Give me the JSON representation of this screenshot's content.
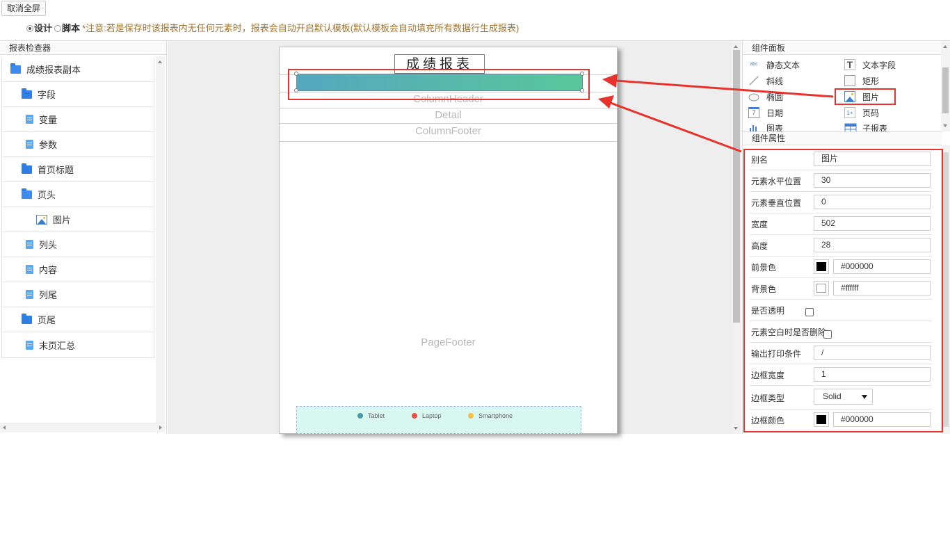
{
  "toolbar": {
    "exit_fullscreen": "取消全屏"
  },
  "mode": {
    "design": "设计",
    "script": "脚本",
    "notice": "*注意:若是保存时该报表内无任何元素时，报表会自动开启默认模板(默认模板会自动填充所有数据行生成报表)"
  },
  "inspector": {
    "title": "报表检查器",
    "items": [
      {
        "label": "成绩报表副本",
        "icon": "folder-open-icon"
      },
      {
        "label": "字段",
        "icon": "folder-icon"
      },
      {
        "label": "变量",
        "icon": "file-icon"
      },
      {
        "label": "参数",
        "icon": "file-icon"
      },
      {
        "label": "首页标题",
        "icon": "folder-icon"
      },
      {
        "label": "页头",
        "icon": "folder-open-icon"
      },
      {
        "label": "图片",
        "icon": "image-icon"
      },
      {
        "label": "列头",
        "icon": "file-icon"
      },
      {
        "label": "内容",
        "icon": "file-icon"
      },
      {
        "label": "列尾",
        "icon": "file-icon"
      },
      {
        "label": "页尾",
        "icon": "folder-icon"
      },
      {
        "label": "末页汇总",
        "icon": "file-icon"
      }
    ]
  },
  "canvas": {
    "report_title": "成绩报表",
    "bands": {
      "column_header": "ColumnHeader",
      "detail": "Detail",
      "column_footer": "ColumnFooter",
      "page_footer": "PageFooter"
    },
    "legend": [
      {
        "label": "Tablet",
        "color": "#4a9aa6"
      },
      {
        "label": "Laptop",
        "color": "#e8504a"
      },
      {
        "label": "Smartphone",
        "color": "#f1c04a"
      }
    ],
    "image_gradient": [
      "#54a8be",
      "#5ac69b"
    ]
  },
  "components": {
    "title": "组件面板",
    "items": [
      {
        "label": "静态文本",
        "icon": "static-text-icon"
      },
      {
        "label": "文本字段",
        "icon": "text-field-icon"
      },
      {
        "label": "斜线",
        "icon": "line-icon"
      },
      {
        "label": "矩形",
        "icon": "rectangle-icon"
      },
      {
        "label": "椭圆",
        "icon": "ellipse-icon"
      },
      {
        "label": "图片",
        "icon": "image-icon"
      },
      {
        "label": "日期",
        "icon": "calendar-icon"
      },
      {
        "label": "页码",
        "icon": "page-number-icon"
      },
      {
        "label": "图表",
        "icon": "chart-icon"
      },
      {
        "label": "子报表",
        "icon": "subreport-icon"
      }
    ]
  },
  "properties": {
    "title": "组件属性",
    "alias": {
      "label": "别名",
      "value": "图片"
    },
    "x": {
      "label": "元素水平位置",
      "value": "30"
    },
    "y": {
      "label": "元素垂直位置",
      "value": "0"
    },
    "width": {
      "label": "宽度",
      "value": "502"
    },
    "height": {
      "label": "高度",
      "value": "28"
    },
    "fg": {
      "label": "前景色",
      "value": "#000000",
      "swatch": "#000000"
    },
    "bg": {
      "label": "背景色",
      "value": "#ffffff",
      "swatch": "#ffffff"
    },
    "transparent": {
      "label": "是否透明"
    },
    "remove_blank": {
      "label": "元素空白时是否删除"
    },
    "print_when": {
      "label": "输出打印条件",
      "value": "/"
    },
    "border_width": {
      "label": "边框宽度",
      "value": "1"
    },
    "border_type": {
      "label": "边框类型",
      "value": "Solid"
    },
    "border_color": {
      "label": "边框颜色",
      "value": "#000000",
      "swatch": "#000000"
    }
  },
  "annotation_color": "#e8322c"
}
